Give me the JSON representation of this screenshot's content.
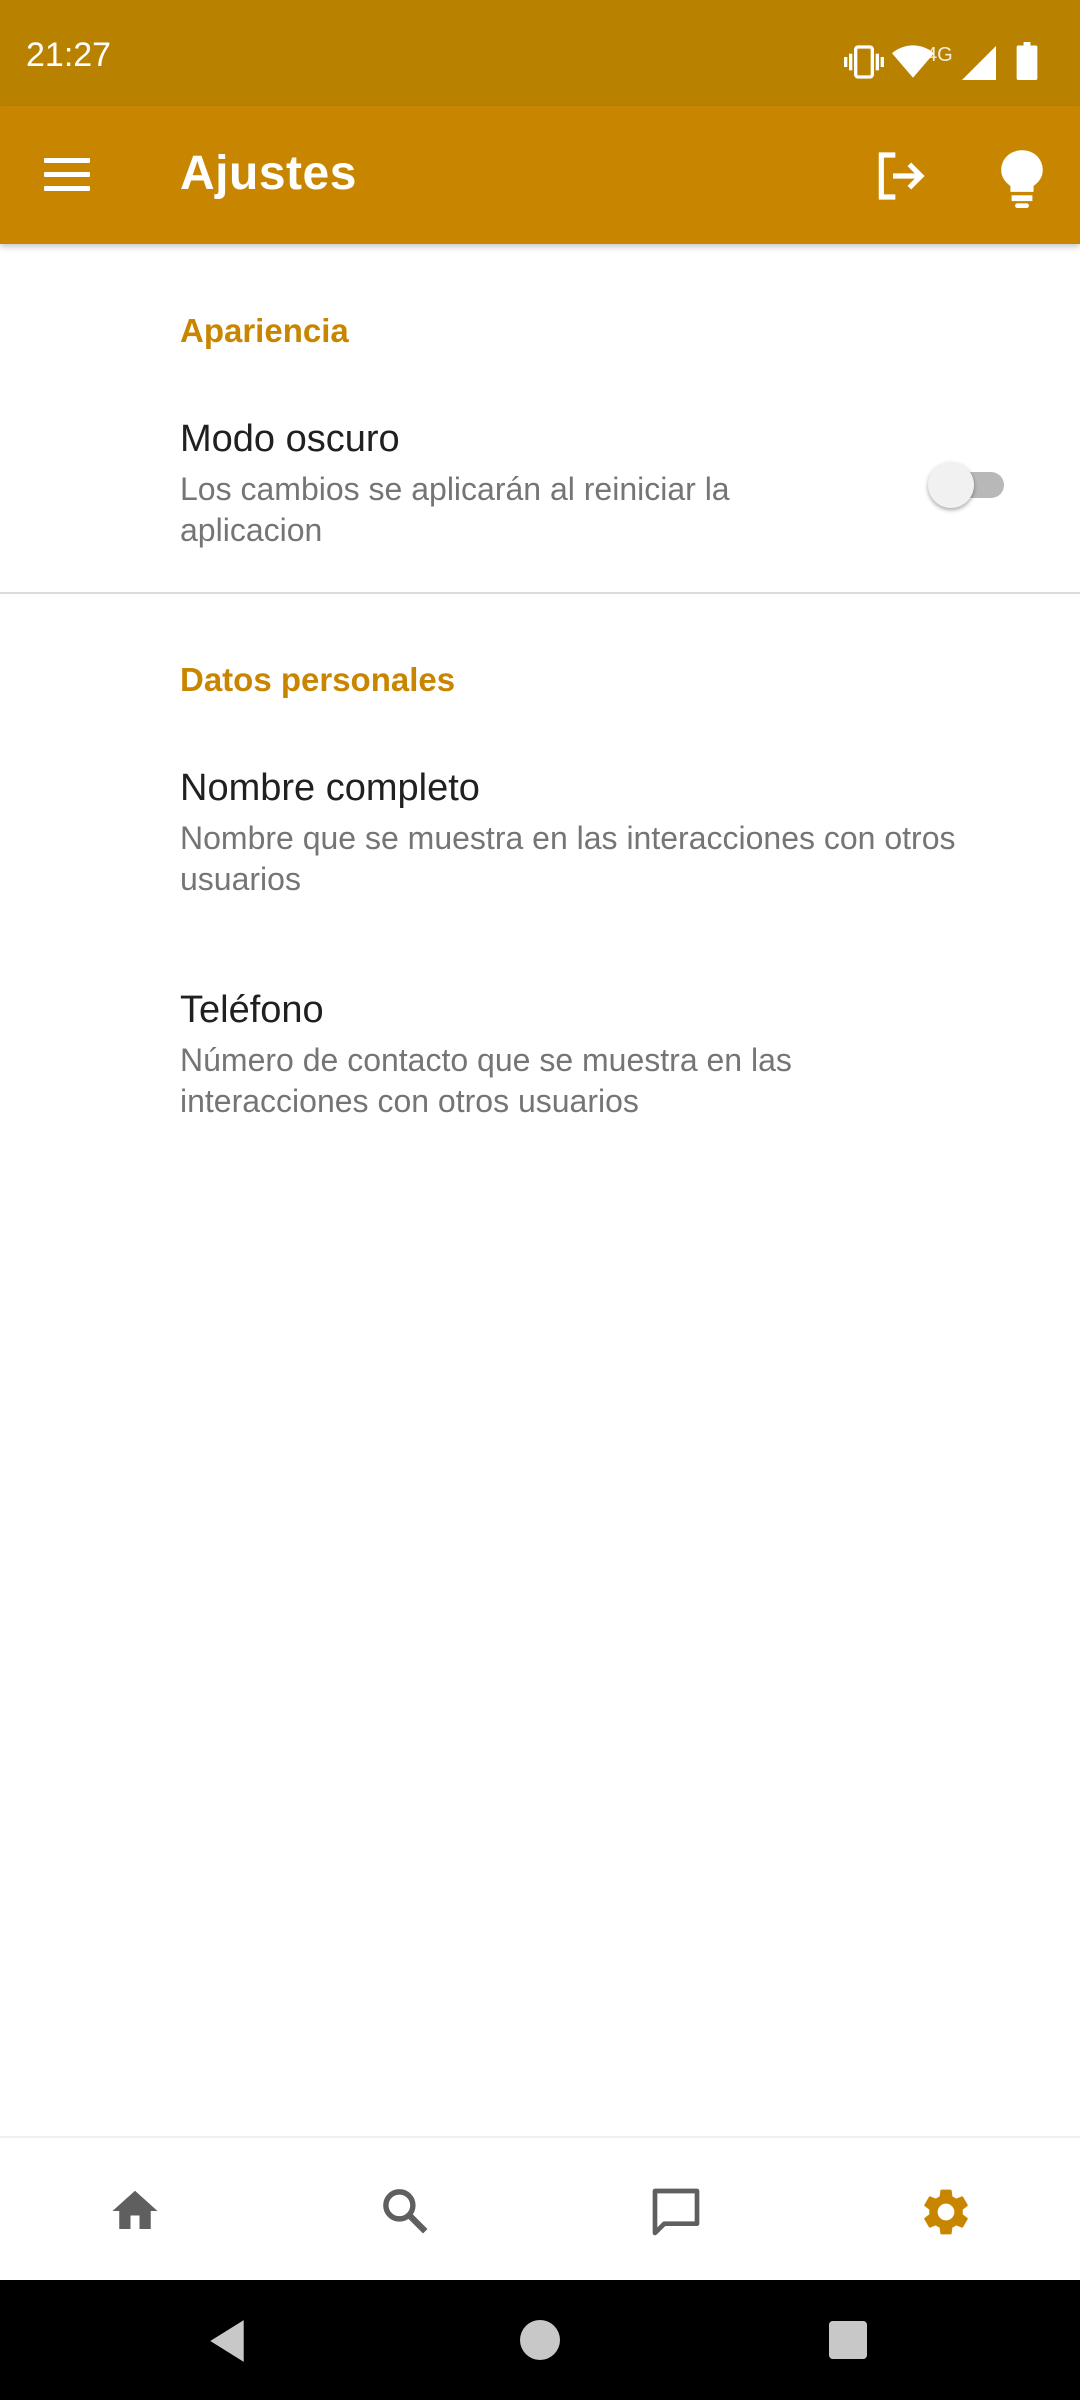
{
  "status_bar": {
    "time": "21:27",
    "network": "4G",
    "icons": [
      "vibrate-icon",
      "wifi-icon",
      "cell-signal-icon",
      "battery-icon"
    ]
  },
  "app_bar": {
    "title": "Ajustes",
    "icons": [
      "menu-icon",
      "logout-icon",
      "lightbulb-icon"
    ],
    "color": "#c88600"
  },
  "sections": {
    "appearance": {
      "title": "Apariencia",
      "dark_mode": {
        "title": "Modo oscuro",
        "summary": "Los cambios se aplicarán al reiniciar la aplicacion",
        "enabled": false
      }
    },
    "personal": {
      "title": "Datos personales",
      "full_name": {
        "title": "Nombre completo",
        "summary": "Nombre que se muestra en las interacciones con otros usuarios"
      },
      "phone": {
        "title": "Teléfono",
        "summary": "Número de contacto que se muestra en las interacciones con otros usuarios"
      }
    }
  },
  "bottom_nav": {
    "items": [
      "home-icon",
      "search-icon",
      "chat-icon",
      "settings-icon"
    ],
    "active": "settings-icon",
    "active_color": "#c88600",
    "inactive_color": "#5f5f5f"
  },
  "system_nav": [
    "back-button",
    "home-button",
    "recents-button"
  ]
}
